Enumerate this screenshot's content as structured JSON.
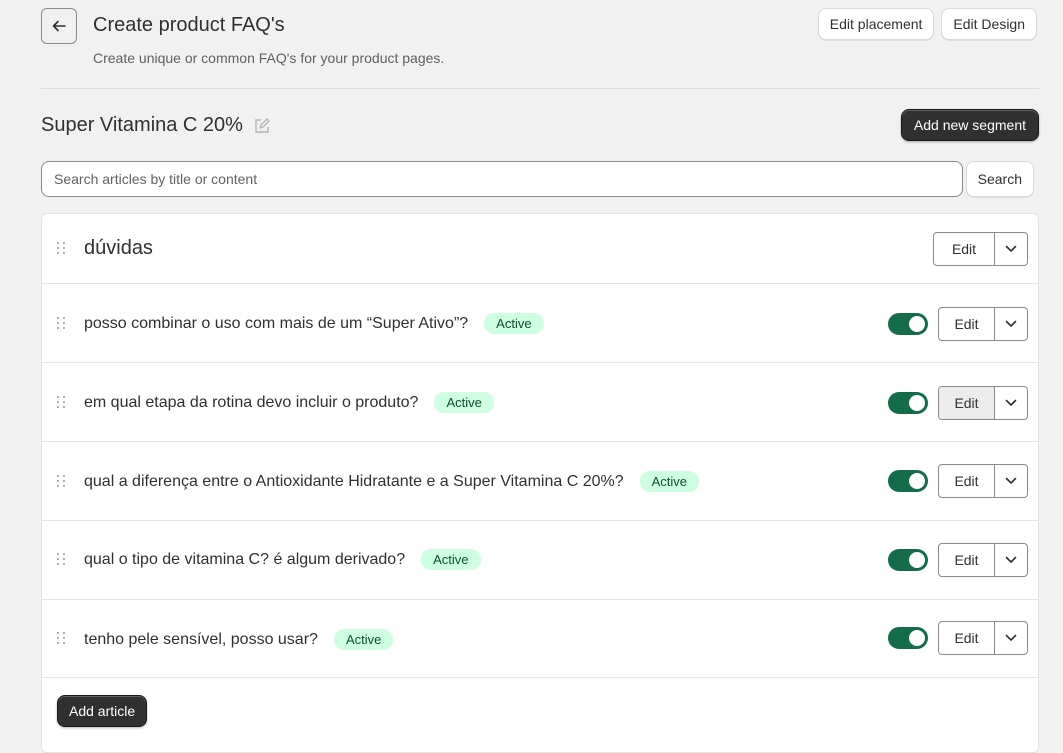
{
  "header": {
    "title": "Create product FAQ's",
    "subtitle": "Create unique or common FAQ's for your product pages.",
    "actions": [
      "Edit placement",
      "Edit Design"
    ]
  },
  "segment": {
    "title": "Super Vitamina C 20%",
    "add_button": "Add new segment",
    "group_name": "dúvidas"
  },
  "search": {
    "placeholder": "Search articles by title or content",
    "value": "",
    "button": "Search"
  },
  "articles": [
    {
      "question": "posso combinar o uso com mais de um “Super Ativo”?",
      "status": "Active",
      "enabled": true
    },
    {
      "question": "em qual etapa da rotina devo incluir o produto?",
      "status": "Active",
      "enabled": true
    },
    {
      "question": "qual a diferença entre o Antioxidante Hidratante e a Super Vitamina C 20%?",
      "status": "Active",
      "enabled": true
    },
    {
      "question": "qual o tipo de vitamina C? é algum derivado?",
      "status": "Active",
      "enabled": true
    },
    {
      "question": "tenho pele sensível, posso usar?",
      "status": "Active",
      "enabled": true
    }
  ],
  "labels": {
    "edit": "Edit",
    "add_article": "Add article"
  },
  "icons": {
    "back": "arrow-left-icon",
    "edit_title": "pencil-square-icon",
    "drag": "drag-handle-icon",
    "dropdown": "chevron-down-icon"
  },
  "colors": {
    "toggle_on": "#136d4a",
    "badge_bg": "#cdfee1",
    "badge_text": "#0c5132",
    "primary_button": "#303030"
  }
}
